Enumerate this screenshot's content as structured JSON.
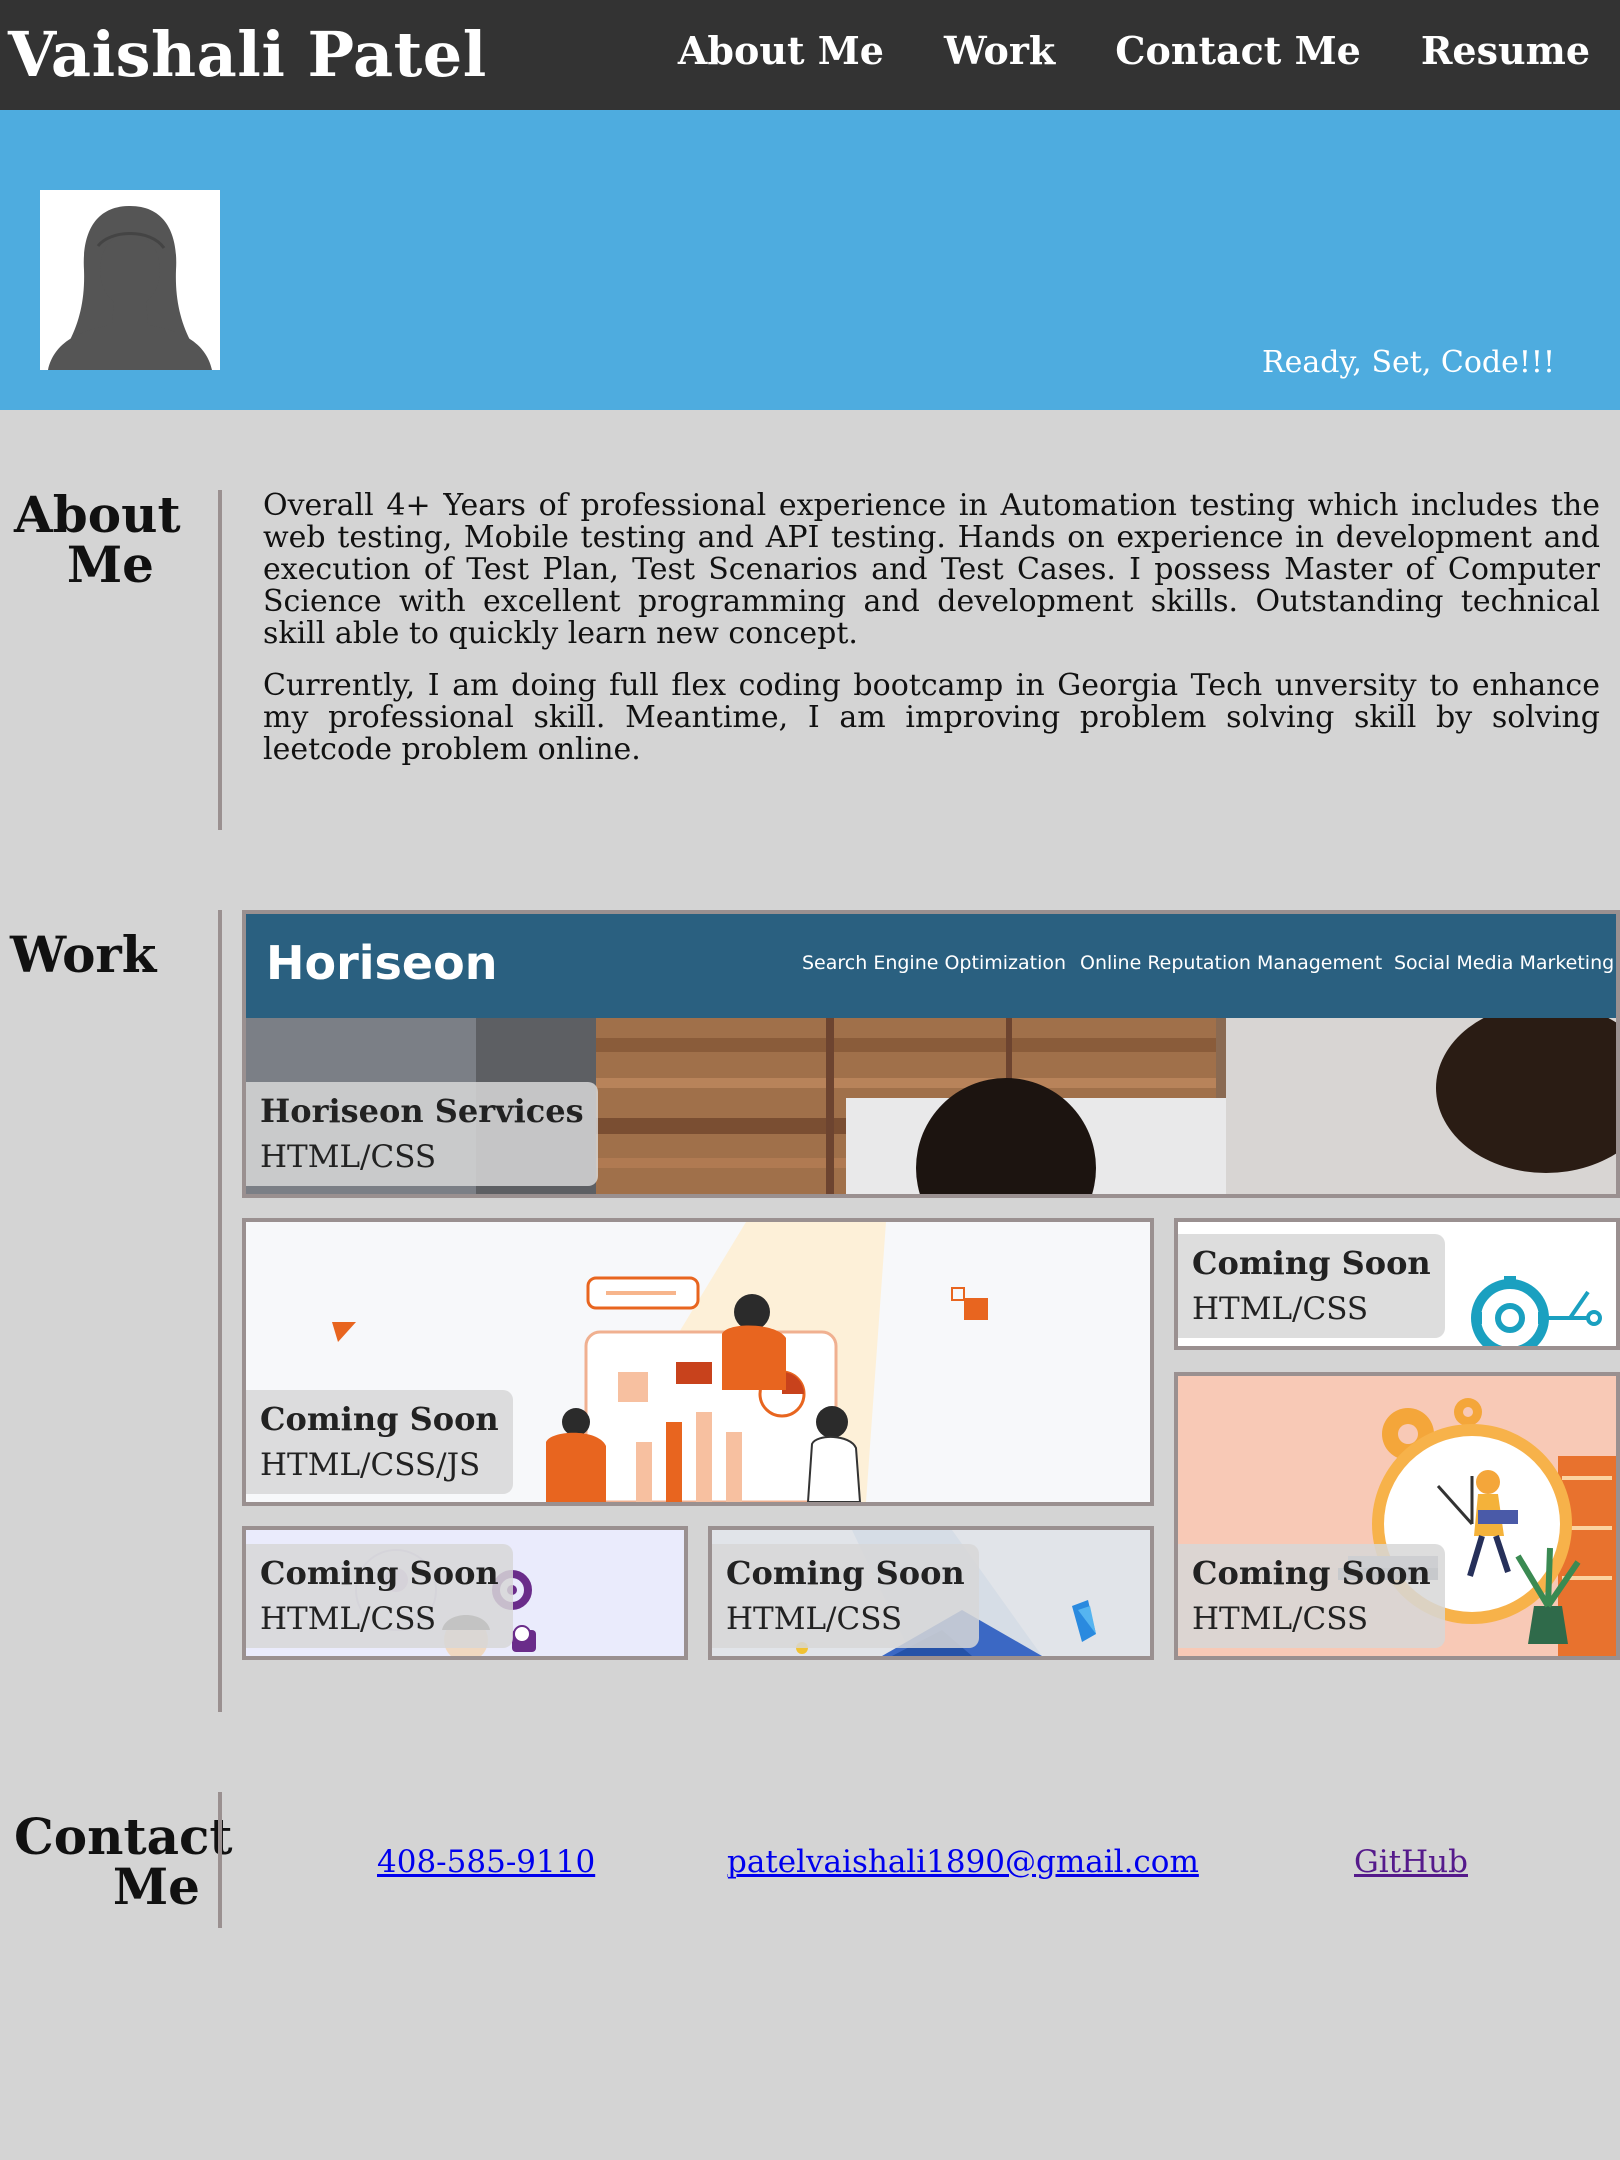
{
  "header": {
    "name": "Vaishali Patel",
    "nav": [
      "About Me",
      "Work",
      "Contact Me",
      "Resume"
    ]
  },
  "hero": {
    "avatar_icon": "female-silhouette-icon",
    "tagline": "Ready, Set, Code!!!"
  },
  "about": {
    "title": "About Me",
    "paragraphs": [
      "Overall 4+ Years of professional experience in Automation testing which includes the web testing, Mobile testing and API testing. Hands on experience in development and execution of Test Plan, Test Scenarios and Test Cases. I possess Master of Computer Science with excellent programming and development skills. Outstanding technical skill able to quickly learn new concept.",
      "Currently, I am doing full flex coding bootcamp in Georgia Tech unversity to enhance my professional skill. Meantime, I am improving problem solving skill by solving leetcode problem online."
    ]
  },
  "work": {
    "title": "Work",
    "featured": {
      "screenshot": {
        "logo": "Horiseon",
        "nav": [
          "Search Engine Optimization",
          "Online Reputation Management",
          "Social Media Marketing"
        ]
      },
      "title": "Horiseon Services",
      "tech": "HTML/CSS"
    },
    "projects": [
      {
        "title": "Coming Soon",
        "tech": "HTML/CSS/JS"
      },
      {
        "title": "Coming Soon",
        "tech": "HTML/CSS"
      },
      {
        "title": "Coming Soon",
        "tech": "HTML/CSS"
      },
      {
        "title": "Coming Soon",
        "tech": "HTML/CSS"
      },
      {
        "title": "Coming Soon",
        "tech": "HTML/CSS"
      }
    ]
  },
  "contact": {
    "title": "Contact Me",
    "phone": "408-585-9110",
    "email": "patelvaishali1890@gmail.com",
    "github": "GitHub"
  },
  "colors": {
    "header_bg": "#333333",
    "hero_bg": "#4eacdf",
    "page_bg": "#d4d4d4",
    "divider": "#9a9090",
    "link": "#0000ee",
    "link_visited": "#551a8b"
  }
}
